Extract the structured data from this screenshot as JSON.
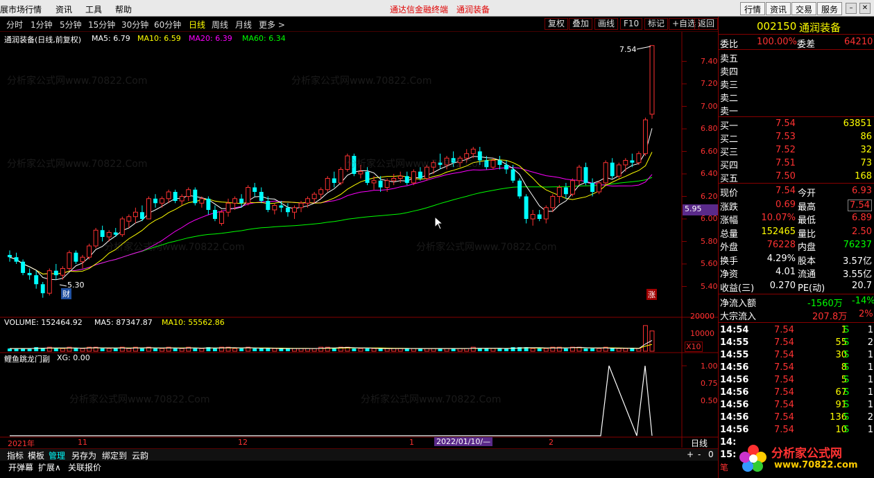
{
  "menu": {
    "items": [
      "展市场行情",
      "资讯",
      "工具",
      "帮助"
    ],
    "center_red": [
      "通达信金融终端",
      "通润装备"
    ],
    "right_buttons": [
      "行情",
      "资讯",
      "交易",
      "服务"
    ]
  },
  "periods": [
    "分时",
    "1分钟",
    "5分钟",
    "15分钟",
    "30分钟",
    "60分钟",
    "日线",
    "周线",
    "月线",
    "更多 >"
  ],
  "selected_period": "日线",
  "toolbar": [
    "复权",
    "叠加",
    "画线",
    "F10",
    "标记",
    "+自选",
    "返回"
  ],
  "main_info": {
    "name": "通润装备(日线,前复权)",
    "ma5": "MA5: 6.79",
    "ma10": "MA10: 6.59",
    "ma20": "MA20: 6.39",
    "ma60": "MA60: 6.34"
  },
  "price_axis": [
    "7.40",
    "7.20",
    "7.00",
    "6.80",
    "6.60",
    "6.40",
    "6.20",
    "6.00",
    "5.80",
    "5.60",
    "5.40"
  ],
  "price_marker": "5.95",
  "high_label": "7.54",
  "low_label": "5.30",
  "cai_badge": "财",
  "zhang_badge": "涨",
  "volume_info": {
    "volume": "VOLUME: 152464.92",
    "ma5": "MA5: 87347.87",
    "ma10": "MA10: 55562.86"
  },
  "volume_axis": [
    "20000",
    "10000"
  ],
  "volume_unit": "X10",
  "indicator_info": {
    "name": "鲤鱼跳龙门副",
    "xg": "XG: 0.00"
  },
  "indicator_axis": [
    "1.00",
    "0.75",
    "0.50"
  ],
  "timeline": {
    "labels": [
      "2021年",
      "11",
      "12",
      "1",
      "2"
    ],
    "cursor": "2022/01/10/—"
  },
  "chart_data": {
    "type": "candlestick",
    "title": "通润装备(日线,前复权)",
    "yrange": [
      5.2,
      7.6
    ],
    "candles": [
      [
        5.68,
        5.72,
        5.62,
        5.66
      ],
      [
        5.66,
        5.7,
        5.6,
        5.62
      ],
      [
        5.62,
        5.64,
        5.5,
        5.52
      ],
      [
        5.52,
        5.56,
        5.46,
        5.5
      ],
      [
        5.5,
        5.54,
        5.38,
        5.42
      ],
      [
        5.42,
        5.44,
        5.3,
        5.34
      ],
      [
        5.34,
        5.56,
        5.32,
        5.54
      ],
      [
        5.54,
        5.6,
        5.46,
        5.5
      ],
      [
        5.5,
        5.58,
        5.46,
        5.56
      ],
      [
        5.56,
        5.72,
        5.54,
        5.7
      ],
      [
        5.7,
        5.72,
        5.6,
        5.62
      ],
      [
        5.62,
        5.68,
        5.56,
        5.66
      ],
      [
        5.66,
        5.78,
        5.64,
        5.76
      ],
      [
        5.76,
        5.92,
        5.74,
        5.9
      ],
      [
        5.9,
        5.94,
        5.8,
        5.84
      ],
      [
        5.84,
        5.9,
        5.8,
        5.88
      ],
      [
        5.88,
        5.92,
        5.84,
        5.86
      ],
      [
        5.86,
        6.02,
        5.84,
        6.0
      ],
      [
        5.98,
        6.04,
        5.92,
        6.02
      ],
      [
        6.02,
        6.1,
        5.96,
        6.06
      ],
      [
        6.06,
        6.12,
        5.98,
        6.0
      ],
      [
        6.0,
        6.2,
        6.0,
        6.18
      ],
      [
        6.18,
        6.22,
        6.1,
        6.14
      ],
      [
        6.14,
        6.2,
        6.1,
        6.18
      ],
      [
        6.18,
        6.26,
        6.14,
        6.24
      ],
      [
        6.24,
        6.26,
        6.14,
        6.16
      ],
      [
        6.16,
        6.22,
        6.12,
        6.2
      ],
      [
        6.2,
        6.28,
        6.16,
        6.26
      ],
      [
        6.26,
        6.28,
        6.12,
        6.14
      ],
      [
        6.14,
        6.2,
        6.1,
        6.18
      ],
      [
        6.18,
        6.2,
        6.04,
        6.08
      ],
      [
        6.08,
        6.12,
        5.98,
        6.0
      ],
      [
        5.96,
        6.08,
        5.94,
        6.06
      ],
      [
        6.06,
        6.18,
        6.02,
        6.14
      ],
      [
        6.14,
        6.2,
        6.08,
        6.18
      ],
      [
        6.18,
        6.22,
        6.1,
        6.14
      ],
      [
        6.14,
        6.3,
        6.12,
        6.28
      ],
      [
        6.28,
        6.32,
        6.2,
        6.24
      ],
      [
        6.24,
        6.28,
        6.14,
        6.16
      ],
      [
        6.16,
        6.2,
        6.06,
        6.08
      ],
      [
        6.08,
        6.14,
        6.04,
        6.12
      ],
      [
        6.12,
        6.16,
        6.06,
        6.1
      ],
      [
        6.1,
        6.14,
        6.02,
        6.06
      ],
      [
        6.06,
        6.12,
        6.0,
        6.1
      ],
      [
        6.1,
        6.16,
        6.06,
        6.14
      ],
      [
        6.14,
        6.2,
        6.1,
        6.18
      ],
      [
        6.18,
        6.24,
        6.14,
        6.22
      ],
      [
        6.22,
        6.28,
        6.18,
        6.26
      ],
      [
        6.26,
        6.38,
        6.24,
        6.36
      ],
      [
        6.36,
        6.42,
        6.28,
        6.32
      ],
      [
        6.32,
        6.46,
        6.3,
        6.44
      ],
      [
        6.44,
        6.58,
        6.42,
        6.56
      ],
      [
        6.56,
        6.58,
        6.38,
        6.4
      ],
      [
        6.4,
        6.48,
        6.36,
        6.42
      ],
      [
        6.42,
        6.46,
        6.3,
        6.32
      ],
      [
        6.32,
        6.38,
        6.26,
        6.34
      ],
      [
        6.34,
        6.38,
        6.24,
        6.28
      ],
      [
        6.28,
        6.36,
        6.24,
        6.34
      ],
      [
        6.34,
        6.4,
        6.3,
        6.36
      ],
      [
        6.36,
        6.42,
        6.32,
        6.38
      ],
      [
        6.38,
        6.42,
        6.3,
        6.32
      ],
      [
        6.32,
        6.44,
        6.3,
        6.42
      ],
      [
        6.42,
        6.46,
        6.34,
        6.36
      ],
      [
        6.36,
        6.48,
        6.34,
        6.46
      ],
      [
        6.46,
        6.52,
        6.4,
        6.5
      ],
      [
        6.5,
        6.58,
        6.44,
        6.48
      ],
      [
        6.48,
        6.56,
        6.44,
        6.54
      ],
      [
        6.54,
        6.6,
        6.46,
        6.5
      ],
      [
        6.5,
        6.56,
        6.46,
        6.54
      ],
      [
        6.54,
        6.62,
        6.5,
        6.58
      ],
      [
        6.58,
        6.64,
        6.54,
        6.62
      ],
      [
        6.6,
        6.64,
        6.48,
        6.52
      ],
      [
        6.52,
        6.56,
        6.44,
        6.46
      ],
      [
        6.46,
        6.54,
        6.44,
        6.52
      ],
      [
        6.52,
        6.56,
        6.44,
        6.48
      ],
      [
        6.48,
        6.52,
        6.4,
        6.44
      ],
      [
        6.44,
        6.48,
        6.32,
        6.34
      ],
      [
        6.34,
        6.36,
        6.18,
        6.2
      ],
      [
        6.2,
        6.22,
        5.96,
        6.0
      ],
      [
        6.0,
        6.08,
        5.94,
        6.04
      ],
      [
        6.04,
        6.08,
        5.98,
        6.0
      ],
      [
        6.0,
        6.12,
        5.96,
        6.1
      ],
      [
        6.1,
        6.22,
        6.06,
        6.2
      ],
      [
        6.2,
        6.3,
        6.14,
        6.28
      ],
      [
        6.28,
        6.32,
        6.18,
        6.22
      ],
      [
        6.22,
        6.36,
        6.2,
        6.34
      ],
      [
        6.34,
        6.48,
        6.3,
        6.46
      ],
      [
        6.46,
        6.5,
        6.3,
        6.32
      ],
      [
        6.32,
        6.36,
        6.2,
        6.24
      ],
      [
        6.24,
        6.34,
        6.22,
        6.32
      ],
      [
        6.32,
        6.52,
        6.3,
        6.5
      ],
      [
        6.5,
        6.54,
        6.36,
        6.38
      ],
      [
        6.38,
        6.5,
        6.36,
        6.48
      ],
      [
        6.48,
        6.54,
        6.42,
        6.52
      ],
      [
        6.52,
        6.58,
        6.46,
        6.5
      ],
      [
        6.5,
        6.6,
        6.48,
        6.58
      ],
      [
        6.58,
        6.9,
        6.56,
        6.88
      ],
      [
        6.93,
        7.54,
        6.89,
        7.54
      ]
    ],
    "volumes": [
      2,
      2,
      2,
      2,
      3,
      2,
      3,
      2,
      2,
      3,
      2,
      2,
      3,
      3,
      2,
      2,
      2,
      3,
      2,
      3,
      2,
      3,
      2,
      2,
      3,
      2,
      2,
      3,
      2,
      2,
      3,
      2,
      3,
      3,
      2,
      2,
      3,
      2,
      2,
      2,
      2,
      2,
      2,
      2,
      2,
      2,
      2,
      3,
      3,
      2,
      3,
      3,
      2,
      2,
      2,
      2,
      2,
      2,
      2,
      2,
      2,
      2,
      2,
      2,
      2,
      2,
      2,
      2,
      2,
      2,
      3,
      2,
      2,
      2,
      2,
      2,
      3,
      3,
      3,
      2,
      2,
      2,
      3,
      3,
      2,
      3,
      3,
      2,
      2,
      2,
      3,
      2,
      2,
      2,
      2,
      2,
      19,
      15
    ],
    "xg_signals": [
      0.0,
      0.0,
      1.0,
      0.0,
      1.0
    ]
  },
  "quote": {
    "code": "002150",
    "name": "通润装备",
    "weibi_label": "委比",
    "weibi_value": "100.00%",
    "weicha_label": "委差",
    "weicha_value": "64210",
    "sells": [
      "卖五",
      "卖四",
      "卖三",
      "卖二",
      "卖一"
    ],
    "buys": [
      {
        "label": "买一",
        "price": "7.54",
        "vol": "63851"
      },
      {
        "label": "买二",
        "price": "7.53",
        "vol": "86"
      },
      {
        "label": "买三",
        "price": "7.52",
        "vol": "32"
      },
      {
        "label": "买四",
        "price": "7.51",
        "vol": "73"
      },
      {
        "label": "买五",
        "price": "7.50",
        "vol": "168"
      }
    ],
    "stats": [
      {
        "l1": "现价",
        "v1": "7.54",
        "l2": "今开",
        "v2": "6.93"
      },
      {
        "l1": "涨跌",
        "v1": "0.69",
        "l2": "最高",
        "v2": "7.54"
      },
      {
        "l1": "涨幅",
        "v1": "10.07%",
        "l2": "最低",
        "v2": "6.89"
      },
      {
        "l1": "总量",
        "v1": "152465",
        "l2": "量比",
        "v2": "2.50"
      },
      {
        "l1": "外盘",
        "v1": "76228",
        "l2": "内盘",
        "v2": "76237"
      },
      {
        "l1": "换手",
        "v1": "4.29%",
        "l2": "股本",
        "v2": "3.57亿"
      },
      {
        "l1": "净资",
        "v1": "4.01",
        "l2": "流通",
        "v2": "3.55亿"
      },
      {
        "l1": "收益(三)",
        "v1": "0.270",
        "l2": "PE(动)",
        "v2": "20.7"
      }
    ],
    "netflow_label": "净流入额",
    "netflow_value": "-1560万",
    "netflow_pct": "-14%",
    "bulk_label": "大宗流入",
    "bulk_value": "207.8万",
    "bulk_pct": "2%",
    "ticks": [
      {
        "t": "14:54",
        "p": "7.54",
        "v": "1",
        "s": "S",
        "n": "1"
      },
      {
        "t": "14:55",
        "p": "7.54",
        "v": "55",
        "s": "S",
        "n": "2"
      },
      {
        "t": "14:55",
        "p": "7.54",
        "v": "30",
        "s": "S",
        "n": "1"
      },
      {
        "t": "14:56",
        "p": "7.54",
        "v": "8",
        "s": "S",
        "n": "1"
      },
      {
        "t": "14:56",
        "p": "7.54",
        "v": "5",
        "s": "S",
        "n": "1"
      },
      {
        "t": "14:56",
        "p": "7.54",
        "v": "67",
        "s": "S",
        "n": "1"
      },
      {
        "t": "14:56",
        "p": "7.54",
        "v": "91",
        "s": "S",
        "n": "1"
      },
      {
        "t": "14:56",
        "p": "7.54",
        "v": "136",
        "s": "S",
        "n": "2"
      },
      {
        "t": "14:56",
        "p": "7.54",
        "v": "10",
        "s": "S",
        "n": "1"
      },
      {
        "t": "14:",
        "p": "",
        "v": "",
        "s": "",
        "n": ""
      },
      {
        "t": "15:",
        "p": "",
        "v": "",
        "s": "",
        "n": ""
      }
    ],
    "bottom_btn": "笔"
  },
  "bottom_tabs": [
    "指标",
    "模板",
    "管理",
    "另存为",
    "绑定到",
    "云韵"
  ],
  "bottom_tabs2": [
    "开弹幕",
    "扩展∧",
    "关联报价"
  ],
  "period_corner": "日线",
  "corner_controls": [
    "+",
    "-",
    "0"
  ],
  "logo": {
    "title": "分析家公式网",
    "url": "www.70822.com"
  },
  "watermark": "分析家公式网www.70822.Com",
  "colors": {
    "up": "#ff3232",
    "down": "#00ffff",
    "ma5": "#ffffff",
    "ma10": "#ffff00",
    "ma20": "#ff00ff",
    "ma60": "#00ff00"
  }
}
